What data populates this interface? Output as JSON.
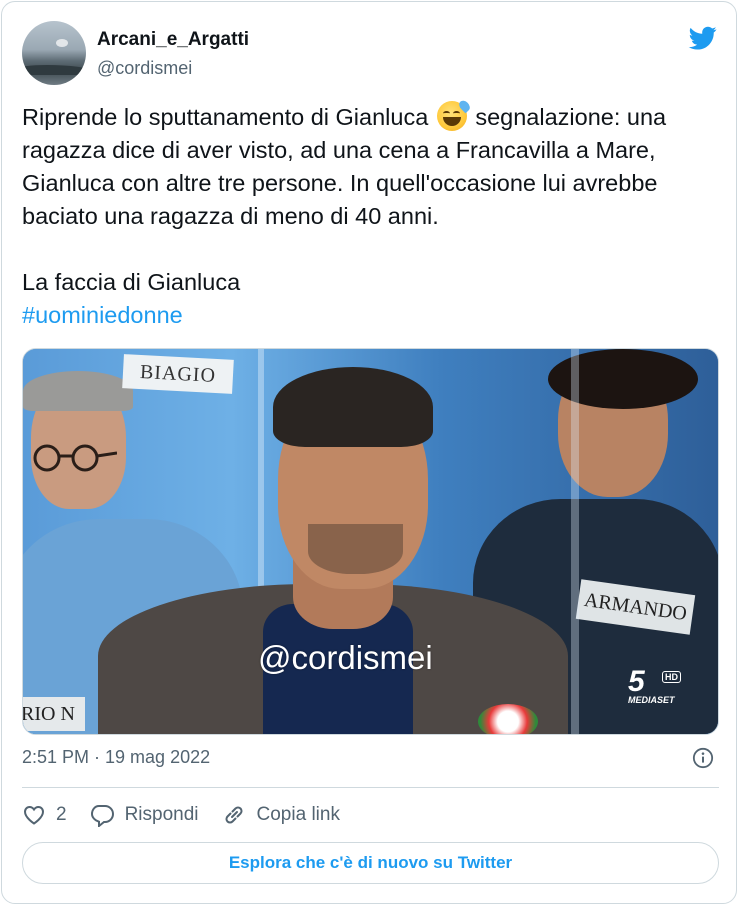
{
  "author": {
    "display_name": "Arcani_e_Argatti",
    "handle": "@cordismei"
  },
  "tweet": {
    "text_part1": "Riprende lo sputtanamento di Gianluca ",
    "emoji": "grinning-face-with-sweat",
    "text_part2": " segnalazione: una ragazza dice di aver visto, ad una cena a Francavilla a Mare, Gianluca con altre tre persone. In quell'occasione lui avrebbe baciato una ragazza di meno di 40 anni.\n\nLa faccia di Gianluca\n",
    "hashtag": "#uominiedonne"
  },
  "media": {
    "name_tag_left": "BIAGIO",
    "name_tag_right": "ARMANDO",
    "name_tag_bottom": "RIO N",
    "watermark": "@cordismei",
    "channel_logo_number": "5",
    "channel_logo_hd": "HD",
    "channel_logo_brand": "MEDIASET"
  },
  "timestamp": "2:51 PM · 19 mag 2022",
  "actions": {
    "like_count": "2",
    "reply_label": "Rispondi",
    "copy_link_label": "Copia link"
  },
  "explore_label": "Esplora che c'è di nuovo su Twitter",
  "colors": {
    "brand_blue": "#1d9bf0",
    "text_primary": "#0f1419",
    "text_secondary": "#536471",
    "border": "#cfd9de"
  },
  "icons": [
    "twitter-bird-icon",
    "info-icon",
    "heart-icon",
    "reply-icon",
    "link-icon"
  ]
}
